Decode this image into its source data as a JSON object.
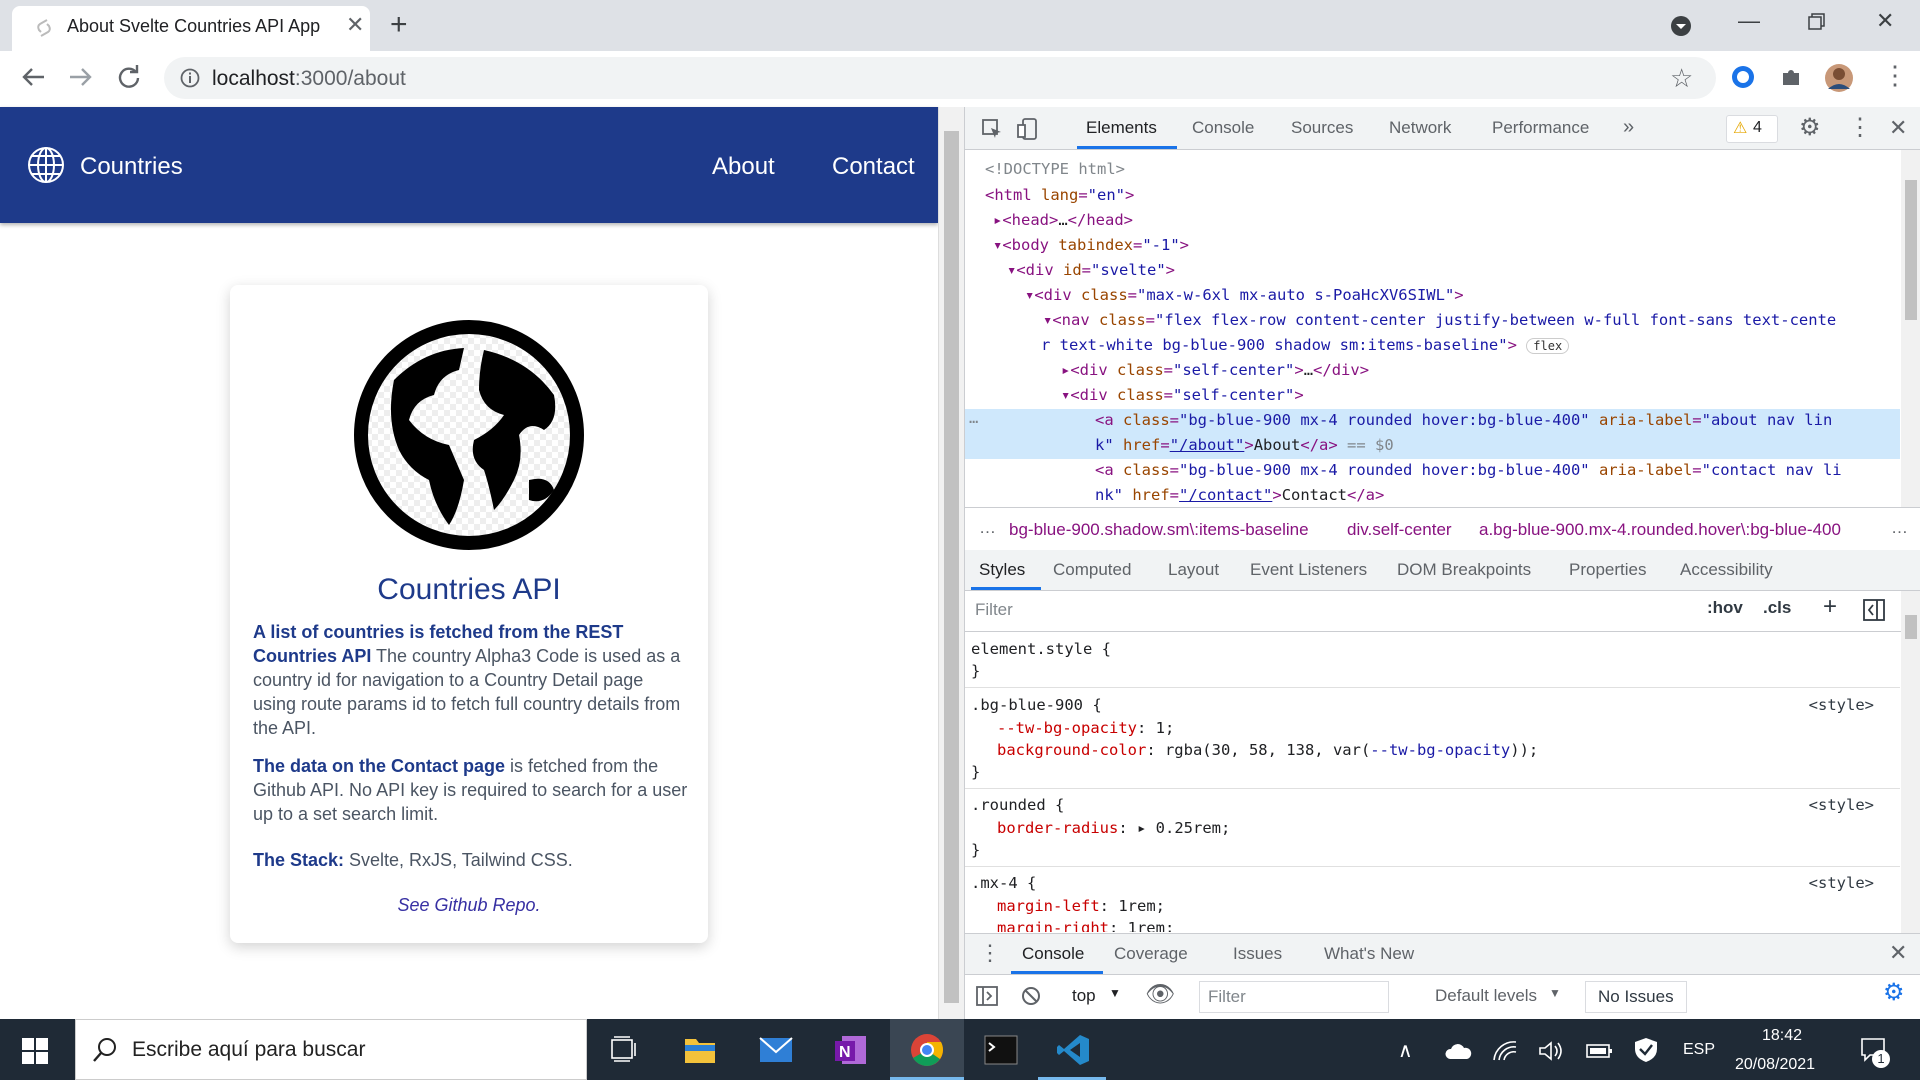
{
  "browser": {
    "tab_title": "About Svelte Countries API App",
    "new_tab": "+",
    "tab_close": "✕",
    "url_host": "localhost",
    "url_path": ":3000/about"
  },
  "page": {
    "brand": "Countries",
    "nav_about": "About",
    "nav_contact": "Contact",
    "card_title": "Countries API",
    "p1_bold": "A list of countries is fetched from the REST Countries API",
    "p1_text": " The country Alpha3 Code is used as a country id for navigation to a Country Detail page using route params id to fetch full country details from the API.",
    "p2_bold": "The data on the Contact page",
    "p2_text": " is fetched from the Github API. No API key is required to search for a user up to a set search limit.",
    "p3_bold": "The Stack:",
    "p3_text": " Svelte, RxJS, Tailwind CSS.",
    "repo_link": "See Github Repo."
  },
  "devtools": {
    "tabs": [
      "Elements",
      "Console",
      "Sources",
      "Network",
      "Performance"
    ],
    "more": "»",
    "warning_count": "4",
    "breadcrumbs": [
      "bg-blue-900.shadow.sm\\:items-baseline",
      "div.self-center",
      "a.bg-blue-900.mx-4.rounded.hover\\:bg-blue-400"
    ],
    "style_tabs": [
      "Styles",
      "Computed",
      "Layout",
      "Event Listeners",
      "DOM Breakpoints",
      "Properties",
      "Accessibility"
    ],
    "filter_placeholder": "Filter",
    "hov": ":hov",
    "cls": ".cls",
    "drawer_tabs": [
      "Console",
      "Coverage",
      "Issues",
      "What's New"
    ],
    "console_context": "top",
    "console_filter": "Filter",
    "default_levels": "Default levels",
    "no_issues": "No Issues",
    "flex_badge": "flex",
    "style_source": "<style>"
  },
  "taskbar": {
    "search_placeholder": "Escribe aquí para buscar",
    "lang": "ESP",
    "time": "18:42",
    "date": "20/08/2021",
    "notif_count": "1"
  }
}
